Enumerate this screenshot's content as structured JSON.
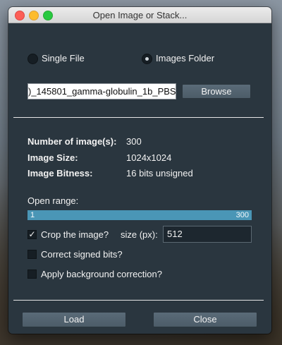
{
  "window": {
    "title": "Open Image or Stack..."
  },
  "mode": {
    "single_file_label": "Single File",
    "images_folder_label": "Images Folder",
    "selected": "images_folder"
  },
  "path": {
    "value": ")_145801_gamma-globulin_1b_PBS"
  },
  "browse_label": "Browse",
  "info": {
    "count_label": "Number of image(s):",
    "count_value": "300",
    "size_label": "Image Size:",
    "size_value": "1024x1024",
    "bitness_label": "Image Bitness:",
    "bitness_value": "16 bits unsigned"
  },
  "open_range": {
    "label": "Open range:",
    "min": "1",
    "max": "300",
    "fill_fraction": 1.0
  },
  "crop": {
    "label": "Crop the image?",
    "checked": true,
    "size_label": "size (px):",
    "size_value": "512"
  },
  "signed": {
    "label": "Correct signed bits?",
    "checked": false
  },
  "background": {
    "label": "Apply background correction?",
    "checked": false
  },
  "buttons": {
    "load": "Load",
    "close": "Close"
  },
  "colors": {
    "window_bg": "#2a363f",
    "range_fill": "#4a96b6"
  }
}
